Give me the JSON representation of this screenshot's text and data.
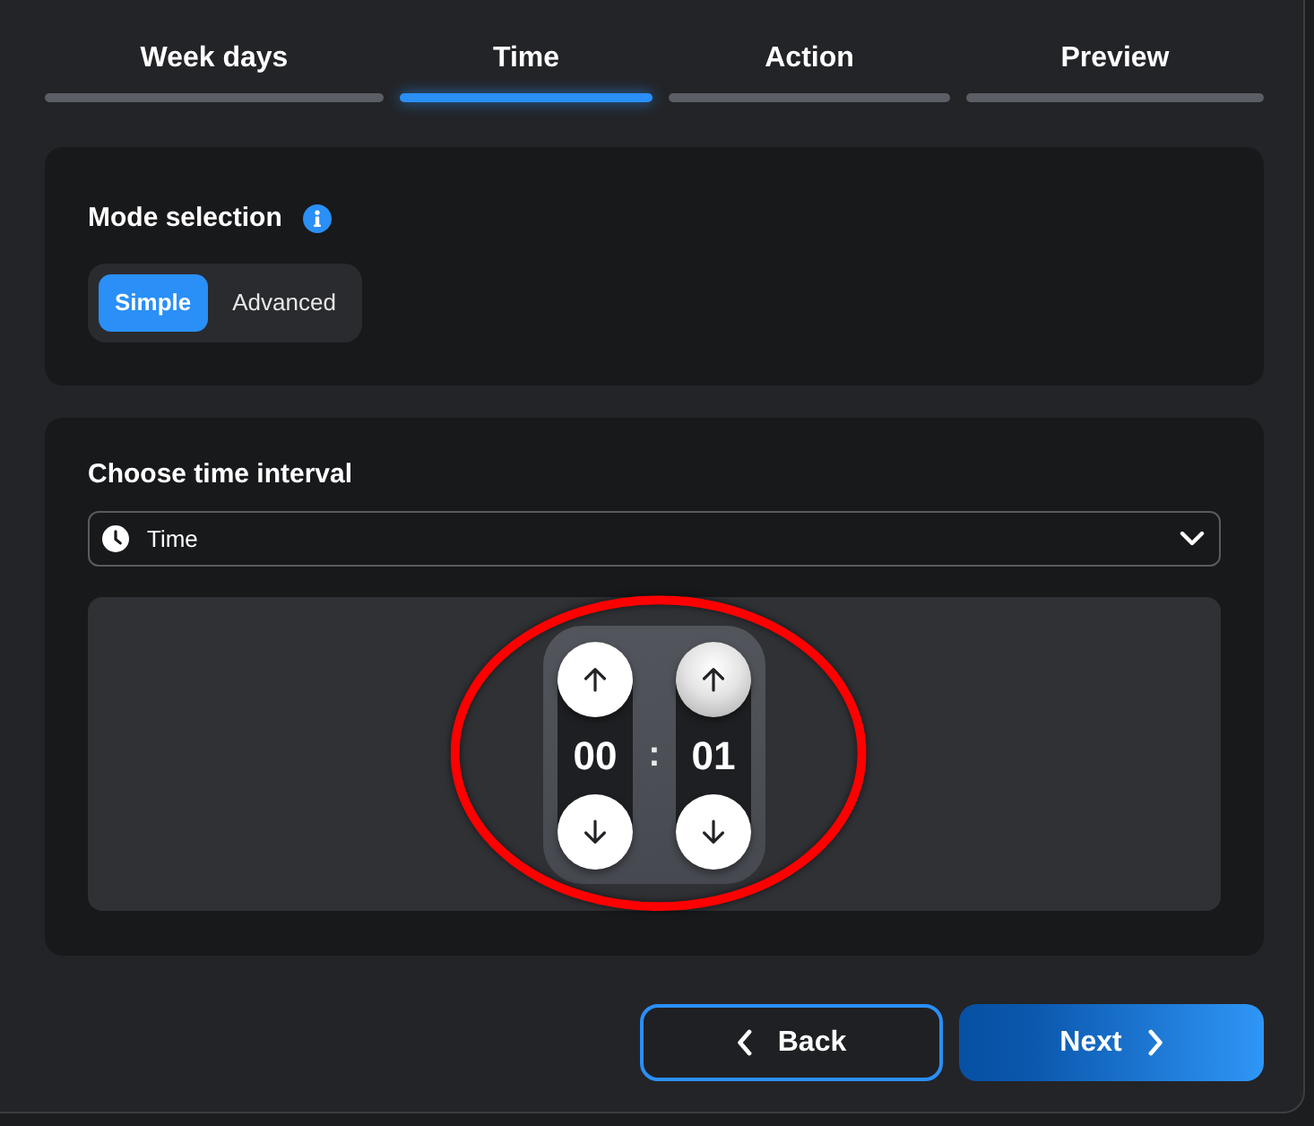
{
  "tabs": [
    {
      "label": "Week days",
      "selected": false
    },
    {
      "label": "Time",
      "selected": true
    },
    {
      "label": "Action",
      "selected": false
    },
    {
      "label": "Preview",
      "selected": false
    }
  ],
  "mode_card": {
    "title": "Mode selection",
    "modes": [
      {
        "label": "Simple",
        "selected": true
      },
      {
        "label": "Advanced",
        "selected": false
      }
    ]
  },
  "interval_card": {
    "title": "Choose time interval",
    "select": {
      "value": "Time"
    },
    "time_picker": {
      "highlighted": true,
      "separator": ":",
      "columns": [
        {
          "value": "00",
          "up": {
            "hovered": false
          },
          "down": {
            "hovered": false
          }
        },
        {
          "value": "01",
          "up": {
            "hovered": true
          },
          "down": {
            "hovered": false
          }
        }
      ]
    }
  },
  "buttons": [
    {
      "kind": "back",
      "label": "Back"
    },
    {
      "kind": "next",
      "label": "Next"
    }
  ]
}
